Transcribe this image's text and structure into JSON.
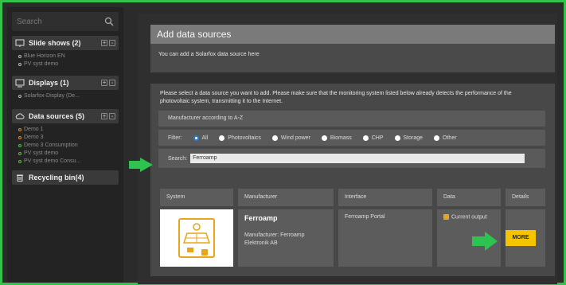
{
  "sidebar": {
    "search_placeholder": "Search",
    "sections": [
      {
        "label": "Slide shows (2)",
        "items": [
          "Blue Horizon EN",
          "PV syst demo"
        ]
      },
      {
        "label": "Displays (1)",
        "items": [
          "Solarfox-Display (De..."
        ]
      },
      {
        "label": "Data sources (5)",
        "items": [
          "Demo 1",
          "Demo 3",
          "Demo 3 Consumption",
          "PV syst demo",
          "PV syst demo Consu..."
        ]
      },
      {
        "label": "Recycling bin(4)",
        "items": []
      }
    ]
  },
  "main": {
    "title": "Add data sources",
    "subtitle": "You can add a Solarfox data source here",
    "intro": "Please select a data source you want to add. Please make sure that the monitoring system listed below already detects the performance of the photovoltaic system, transmitting it to the Internet.",
    "sort_label": "Manufacturer according to A-Z",
    "filter": {
      "label": "Filter:",
      "options": [
        "All",
        "Photovoltaics",
        "Wind power",
        "Biomass",
        "CHP",
        "Storage",
        "Other"
      ],
      "selected": "All"
    },
    "search": {
      "label": "Search:",
      "value": "Ferroamp"
    },
    "table": {
      "headers": [
        "System",
        "Manufacturer",
        "Interface",
        "Data",
        "Details"
      ],
      "row": {
        "name": "Ferroamp",
        "manufacturer": "Manufacturer: Ferroamp Elektronik AB",
        "interface": "Ferroamp Portal",
        "data": "Current output",
        "more_label": "MORE"
      }
    }
  },
  "colors": {
    "accent": "#33c24a",
    "button": "#f5c400",
    "logo": "#e9a51a"
  }
}
